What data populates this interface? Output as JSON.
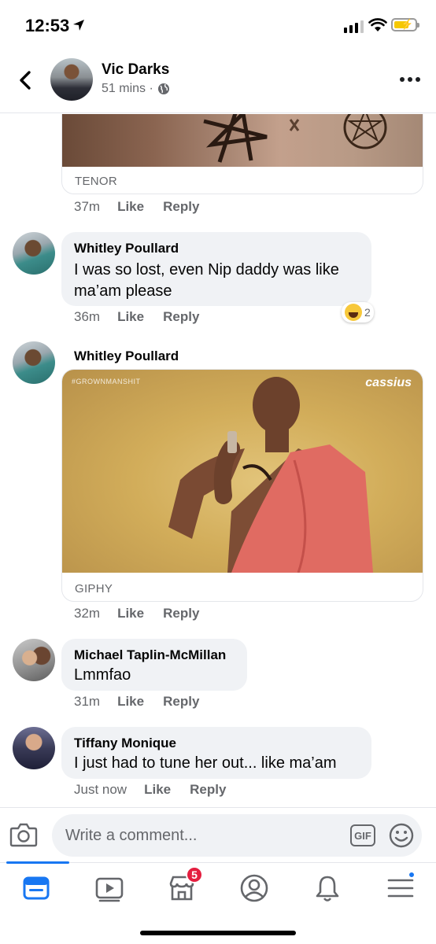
{
  "status_bar": {
    "time": "12:53"
  },
  "header": {
    "name": "Vic Darks",
    "time": "51 mins ·"
  },
  "top_gif": {
    "source": "TENOR",
    "time": "37m",
    "like": "Like",
    "reply": "Reply"
  },
  "comments": [
    {
      "author": "Whitley Poullard",
      "text_line1": "I was so lost, even Nip daddy was like",
      "text_line2": "ma’am please",
      "time": "36m",
      "like": "Like",
      "reply": "Reply",
      "reaction_count": "2"
    },
    {
      "author": "Whitley Poullard",
      "gif_source": "GIPHY",
      "watermark_left": "#GROWNMANSHIT",
      "watermark_right": "cassius",
      "time": "32m",
      "like": "Like",
      "reply": "Reply"
    },
    {
      "author": "Michael Taplin-McMillan",
      "text": "Lmmfao",
      "time": "31m",
      "like": "Like",
      "reply": "Reply"
    },
    {
      "author": "Tiffany Monique",
      "text": "I just had to tune her out... like ma’am",
      "time": "Just now",
      "like": "Like",
      "reply": "Reply"
    }
  ],
  "composer": {
    "placeholder": "Write a comment...",
    "gif_label": "GIF"
  },
  "tab_bar": {
    "marketplace_badge": "5"
  },
  "colors": {
    "accent": "#1877f2",
    "bubble": "#f0f2f5",
    "secondary_text": "#65676b",
    "badge": "#e41e3f"
  }
}
